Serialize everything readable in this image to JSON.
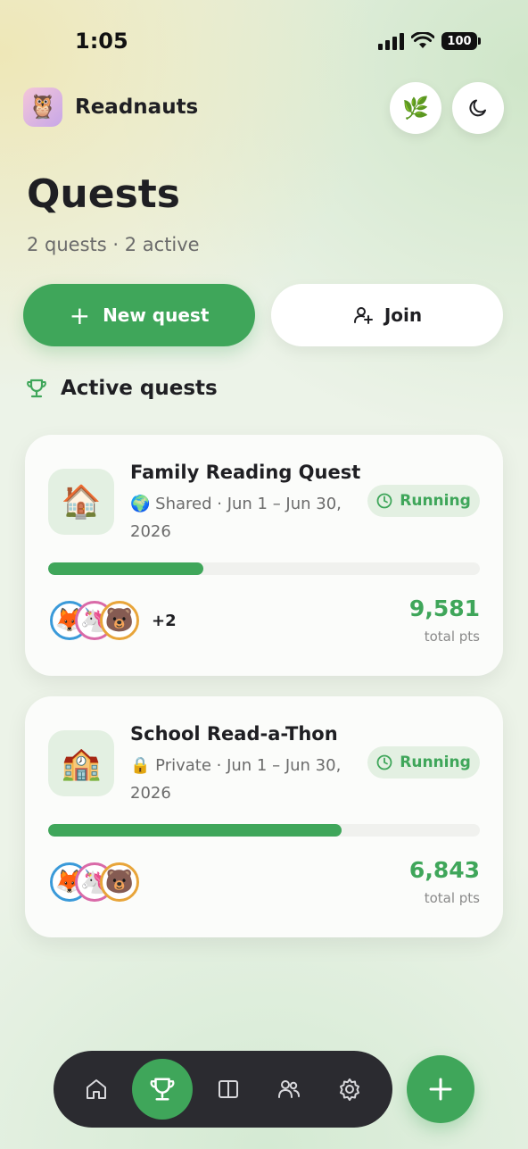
{
  "status_bar": {
    "time": "1:05",
    "battery": "100"
  },
  "header": {
    "app_name": "Readnauts",
    "logo_icon": "owl-reading-icon",
    "leaf_icon": "leaf-icon",
    "theme_icon": "moon-icon"
  },
  "page": {
    "title": "Quests",
    "subtitle": "2 quests · 2 active"
  },
  "actions": {
    "new_quest_label": "New quest",
    "join_label": "Join"
  },
  "section": {
    "title": "Active quests",
    "icon": "trophy-icon"
  },
  "quests": [
    {
      "icon": "🏠",
      "title": "Family Reading Quest",
      "visibility_icon": "🌍",
      "meta": "Shared · Jun 1 – Jun 30, 2026",
      "status": "Running",
      "progress": 0.36,
      "members": [
        "🦊",
        "🦄",
        "🐻"
      ],
      "more_members": "+2",
      "points": "9,581",
      "points_label": "total pts"
    },
    {
      "icon": "🏫",
      "title": "School Read-a-Thon",
      "visibility_icon": "🔒",
      "meta": "Private · Jun 1 – Jun 30, 2026",
      "status": "Running",
      "progress": 0.68,
      "members": [
        "🦊",
        "🦄",
        "🐻"
      ],
      "more_members": "",
      "points": "6,843",
      "points_label": "total pts"
    }
  ],
  "nav": {
    "tabs": [
      "home-icon",
      "trophy-icon",
      "book-icon",
      "people-icon",
      "settings-icon"
    ],
    "active": "trophy-icon"
  },
  "colors": {
    "accent": "#3fa65a",
    "badge_bg": "#e3f0e2",
    "nav_bg": "#2b2b30"
  }
}
